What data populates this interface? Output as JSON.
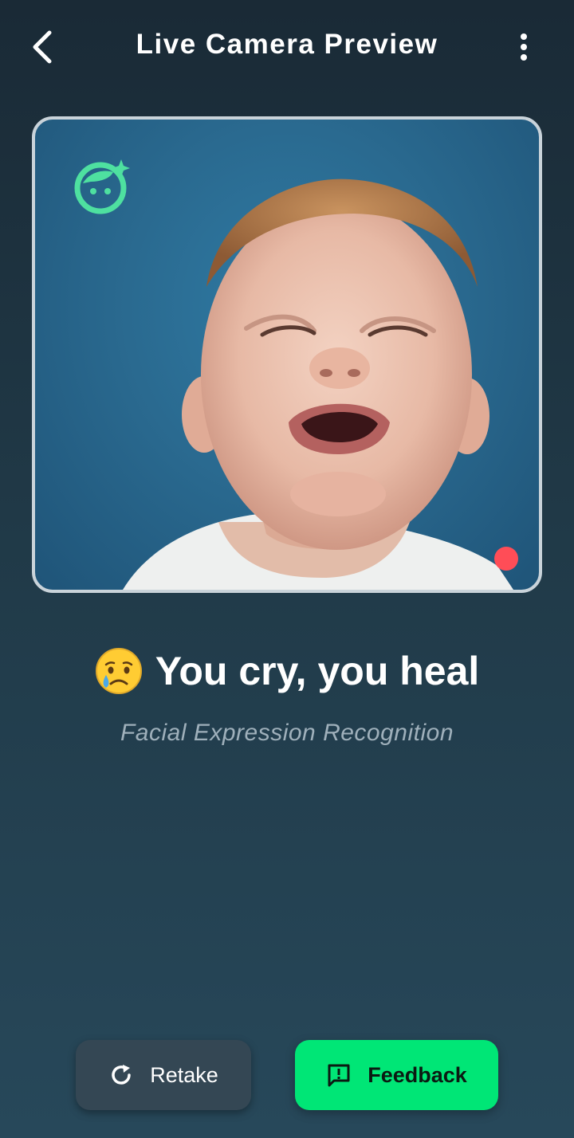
{
  "app_bar": {
    "title": "Live Camera Preview",
    "back_icon": "chevron-left-icon",
    "menu_icon": "more-vertical-icon"
  },
  "preview": {
    "badge_icon": "face-sparkle-icon",
    "recording_indicator": "recording-dot",
    "badge_color": "#4ee0a0",
    "recording_color": "#ff4d57"
  },
  "result": {
    "emoji": "crying-face",
    "text": "You cry, you heal",
    "subtitle": "Facial Expression Recognition"
  },
  "actions": {
    "retake_label": "Retake",
    "retake_icon": "refresh-icon",
    "feedback_label": "Feedback",
    "feedback_icon": "feedback-message-icon",
    "feedback_color": "#00e676"
  }
}
